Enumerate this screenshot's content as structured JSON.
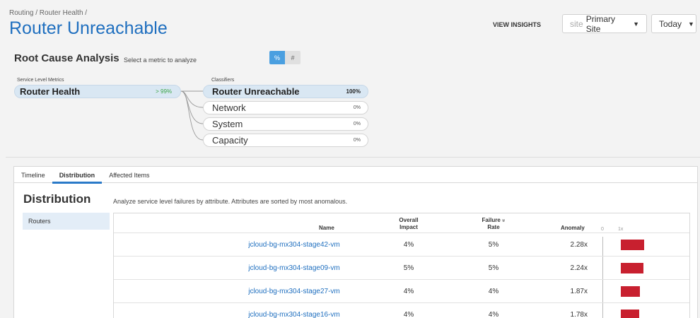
{
  "header": {
    "breadcrumb": "Routing / Router Health /",
    "title": "Router Unreachable",
    "view_insights": "VIEW INSIGHTS",
    "site_prefix": "site",
    "site_value": "Primary Site",
    "date_value": "Today"
  },
  "rca": {
    "title": "Root Cause Analysis",
    "subtitle": "Select a metric to analyze",
    "toggle_percent": "%",
    "toggle_count": "#",
    "metrics_label": "Service Level Metrics",
    "classifiers_label": "Classifiers",
    "metric": {
      "name": "Router Health",
      "pct": "> 99%"
    },
    "classifiers": [
      {
        "name": "Router Unreachable",
        "pct": "100%",
        "selected": true
      },
      {
        "name": "Network",
        "pct": "0%",
        "selected": false
      },
      {
        "name": "System",
        "pct": "0%",
        "selected": false
      },
      {
        "name": "Capacity",
        "pct": "0%",
        "selected": false
      }
    ]
  },
  "tabs": [
    {
      "label": "Timeline",
      "active": false
    },
    {
      "label": "Distribution",
      "active": true
    },
    {
      "label": "Affected Items",
      "active": false
    }
  ],
  "distribution": {
    "title": "Distribution",
    "subtitle": "Analyze service level failures by attribute. Attributes are sorted by most anomalous.",
    "attributes": [
      "Routers"
    ],
    "columns": {
      "name": "Name",
      "impact_1": "Overall",
      "impact_2": "Impact",
      "rate_1": "Failure",
      "rate_2": "Rate",
      "sort_icon": "»",
      "anomaly": "Anomaly",
      "scale_0": "0",
      "scale_1": "1x"
    },
    "rows": [
      {
        "name": "jcloud-bg-mx304-stage42-vm",
        "impact": "4%",
        "rate": "5%",
        "anomaly": "2.28x",
        "anomaly_value": 2.28
      },
      {
        "name": "jcloud-bg-mx304-stage09-vm",
        "impact": "5%",
        "rate": "5%",
        "anomaly": "2.24x",
        "anomaly_value": 2.24
      },
      {
        "name": "jcloud-bg-mx304-stage27-vm",
        "impact": "4%",
        "rate": "4%",
        "anomaly": "1.87x",
        "anomaly_value": 1.87
      },
      {
        "name": "jcloud-bg-mx304-stage16-vm",
        "impact": "4%",
        "rate": "4%",
        "anomaly": "1.78x",
        "anomaly_value": 1.78
      }
    ],
    "bar_color": "#c8202f"
  }
}
